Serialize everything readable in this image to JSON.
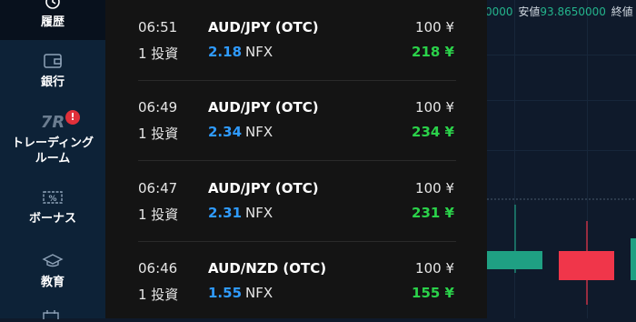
{
  "sidebar": {
    "items": [
      {
        "label": "履歴",
        "icon": "history-icon",
        "active": true
      },
      {
        "label": "銀行",
        "icon": "wallet-icon",
        "active": false
      },
      {
        "label": "トレーディング\nルーム",
        "label_line1": "トレーディング",
        "label_line2": "ルーム",
        "icon": "7r-logo-icon",
        "icon_text": "7R",
        "badge": "!",
        "active": false
      },
      {
        "label": "ボーナス",
        "icon": "coupon-icon",
        "active": false
      },
      {
        "label": "教育",
        "icon": "graduation-cap-icon",
        "active": false
      }
    ]
  },
  "trades": [
    {
      "time": "06:51",
      "pair": "AUD/JPY (OTC)",
      "amount": "100 ¥",
      "investments": "1 投資",
      "multiplier": "2.18",
      "suffix": "NFX",
      "payout": "218 ¥"
    },
    {
      "time": "06:49",
      "pair": "AUD/JPY (OTC)",
      "amount": "100 ¥",
      "investments": "1 投資",
      "multiplier": "2.34",
      "suffix": "NFX",
      "payout": "234 ¥"
    },
    {
      "time": "06:47",
      "pair": "AUD/JPY (OTC)",
      "amount": "100 ¥",
      "investments": "1 投資",
      "multiplier": "2.31",
      "suffix": "NFX",
      "payout": "231 ¥"
    },
    {
      "time": "06:46",
      "pair": "AUD/NZD (OTC)",
      "amount": "100 ¥",
      "investments": "1 投資",
      "multiplier": "1.55",
      "suffix": "NFX",
      "payout": "155 ¥"
    }
  ],
  "chart": {
    "topbar_prefix": "0000",
    "low_label": "安値",
    "low_value": "93.8650000",
    "close_label": "終値",
    "colors": {
      "up": "#1fa083",
      "down": "#f0364a",
      "background": "#0f1a2b"
    }
  }
}
